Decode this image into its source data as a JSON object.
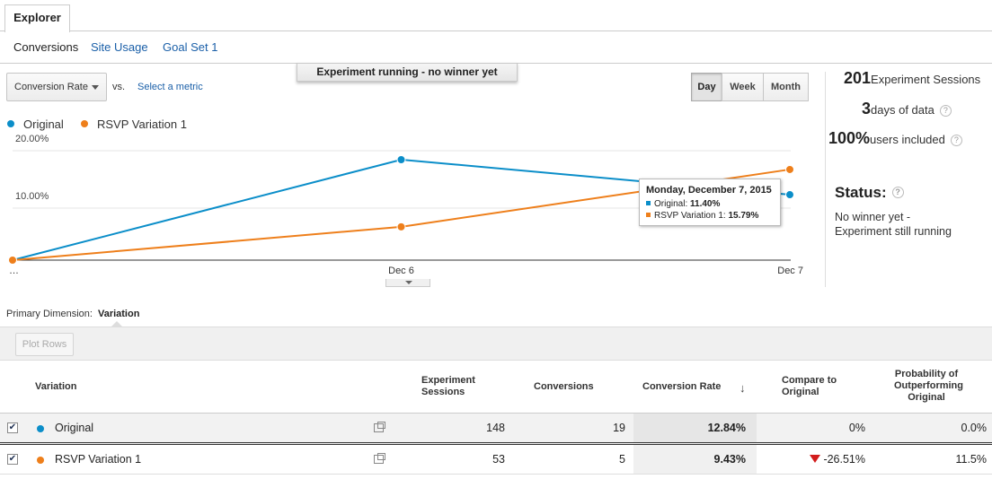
{
  "tabs": {
    "explorer": "Explorer"
  },
  "subnav": {
    "conversions": "Conversions",
    "site_usage": "Site Usage",
    "goal_set": "Goal Set 1"
  },
  "metric": {
    "selected": "Conversion Rate",
    "vs": "vs.",
    "select_metric": "Select a metric"
  },
  "banner": "Experiment running - no winner yet",
  "period": {
    "day": "Day",
    "week": "Week",
    "month": "Month",
    "active": "Day"
  },
  "legend": [
    {
      "label": "Original",
      "color": "#0b8ec9"
    },
    {
      "label": "RSVP Variation 1",
      "color": "#ee7f1b"
    }
  ],
  "chart_data": {
    "type": "line",
    "x": [
      "…",
      "Dec 6",
      "Dec 7"
    ],
    "series": [
      {
        "name": "Original",
        "values": [
          0,
          17.5,
          11.4
        ],
        "color": "#0b8ec9"
      },
      {
        "name": "RSVP Variation 1",
        "values": [
          0,
          5.8,
          15.79
        ],
        "color": "#ee7f1b"
      }
    ],
    "ytick_labels": [
      "10.00%",
      "20.00%"
    ],
    "yticks": [
      10,
      20
    ],
    "ylim": [
      0,
      20
    ],
    "grid": true,
    "legend": "top-left"
  },
  "tooltip": {
    "title": "Monday, December 7, 2015",
    "rows": [
      {
        "label": "Original: ",
        "value": "11.40%",
        "color": "#0b8ec9"
      },
      {
        "label": "RSVP Variation 1: ",
        "value": "15.79%",
        "color": "#ee7f1b"
      }
    ]
  },
  "stats": {
    "sessions_value": "201",
    "sessions_label": "Experiment Sessions",
    "days_value": "3",
    "days_label": "days of data",
    "users_value": "100%",
    "users_label": "users included",
    "status_title": "Status:",
    "status_line1": "No winner yet -",
    "status_line2": "Experiment still running",
    "help": "?"
  },
  "primary_dimension": {
    "label": "Primary Dimension:",
    "value": "Variation"
  },
  "toolbar": {
    "plot_rows": "Plot Rows"
  },
  "table": {
    "headers": {
      "variation": "Variation",
      "sessions_1": "Experiment",
      "sessions_2": "Sessions",
      "conversions": "Conversions",
      "conv_rate": "Conversion Rate",
      "compare_1": "Compare to",
      "compare_2": "Original",
      "prob_1": "Probability of",
      "prob_2": "Outperforming",
      "prob_3": "Original"
    },
    "rows": [
      {
        "name": "Original",
        "color": "#0b8ec9",
        "checked": "✔",
        "sessions": "148",
        "conversions": "19",
        "conv_rate": "12.84%",
        "compare": "0%",
        "probability": "0.0%"
      },
      {
        "name": "RSVP Variation 1",
        "color": "#ee7f1b",
        "checked": "✔",
        "sessions": "53",
        "conversions": "5",
        "conv_rate": "9.43%",
        "compare": "-26.51%",
        "probability": "11.5%"
      }
    ]
  }
}
